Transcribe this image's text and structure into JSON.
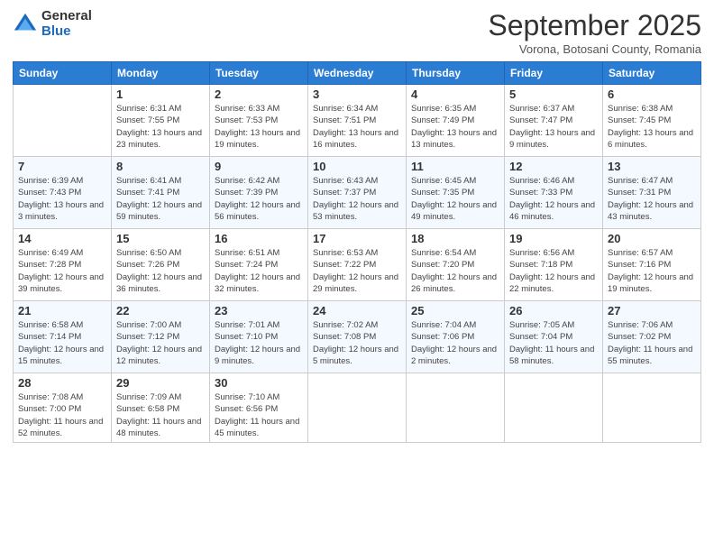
{
  "logo": {
    "general": "General",
    "blue": "Blue"
  },
  "header": {
    "month": "September 2025",
    "location": "Vorona, Botosani County, Romania"
  },
  "weekdays": [
    "Sunday",
    "Monday",
    "Tuesday",
    "Wednesday",
    "Thursday",
    "Friday",
    "Saturday"
  ],
  "weeks": [
    [
      {
        "day": "",
        "sunrise": "",
        "sunset": "",
        "daylight": ""
      },
      {
        "day": "1",
        "sunrise": "Sunrise: 6:31 AM",
        "sunset": "Sunset: 7:55 PM",
        "daylight": "Daylight: 13 hours and 23 minutes."
      },
      {
        "day": "2",
        "sunrise": "Sunrise: 6:33 AM",
        "sunset": "Sunset: 7:53 PM",
        "daylight": "Daylight: 13 hours and 19 minutes."
      },
      {
        "day": "3",
        "sunrise": "Sunrise: 6:34 AM",
        "sunset": "Sunset: 7:51 PM",
        "daylight": "Daylight: 13 hours and 16 minutes."
      },
      {
        "day": "4",
        "sunrise": "Sunrise: 6:35 AM",
        "sunset": "Sunset: 7:49 PM",
        "daylight": "Daylight: 13 hours and 13 minutes."
      },
      {
        "day": "5",
        "sunrise": "Sunrise: 6:37 AM",
        "sunset": "Sunset: 7:47 PM",
        "daylight": "Daylight: 13 hours and 9 minutes."
      },
      {
        "day": "6",
        "sunrise": "Sunrise: 6:38 AM",
        "sunset": "Sunset: 7:45 PM",
        "daylight": "Daylight: 13 hours and 6 minutes."
      }
    ],
    [
      {
        "day": "7",
        "sunrise": "Sunrise: 6:39 AM",
        "sunset": "Sunset: 7:43 PM",
        "daylight": "Daylight: 13 hours and 3 minutes."
      },
      {
        "day": "8",
        "sunrise": "Sunrise: 6:41 AM",
        "sunset": "Sunset: 7:41 PM",
        "daylight": "Daylight: 12 hours and 59 minutes."
      },
      {
        "day": "9",
        "sunrise": "Sunrise: 6:42 AM",
        "sunset": "Sunset: 7:39 PM",
        "daylight": "Daylight: 12 hours and 56 minutes."
      },
      {
        "day": "10",
        "sunrise": "Sunrise: 6:43 AM",
        "sunset": "Sunset: 7:37 PM",
        "daylight": "Daylight: 12 hours and 53 minutes."
      },
      {
        "day": "11",
        "sunrise": "Sunrise: 6:45 AM",
        "sunset": "Sunset: 7:35 PM",
        "daylight": "Daylight: 12 hours and 49 minutes."
      },
      {
        "day": "12",
        "sunrise": "Sunrise: 6:46 AM",
        "sunset": "Sunset: 7:33 PM",
        "daylight": "Daylight: 12 hours and 46 minutes."
      },
      {
        "day": "13",
        "sunrise": "Sunrise: 6:47 AM",
        "sunset": "Sunset: 7:31 PM",
        "daylight": "Daylight: 12 hours and 43 minutes."
      }
    ],
    [
      {
        "day": "14",
        "sunrise": "Sunrise: 6:49 AM",
        "sunset": "Sunset: 7:28 PM",
        "daylight": "Daylight: 12 hours and 39 minutes."
      },
      {
        "day": "15",
        "sunrise": "Sunrise: 6:50 AM",
        "sunset": "Sunset: 7:26 PM",
        "daylight": "Daylight: 12 hours and 36 minutes."
      },
      {
        "day": "16",
        "sunrise": "Sunrise: 6:51 AM",
        "sunset": "Sunset: 7:24 PM",
        "daylight": "Daylight: 12 hours and 32 minutes."
      },
      {
        "day": "17",
        "sunrise": "Sunrise: 6:53 AM",
        "sunset": "Sunset: 7:22 PM",
        "daylight": "Daylight: 12 hours and 29 minutes."
      },
      {
        "day": "18",
        "sunrise": "Sunrise: 6:54 AM",
        "sunset": "Sunset: 7:20 PM",
        "daylight": "Daylight: 12 hours and 26 minutes."
      },
      {
        "day": "19",
        "sunrise": "Sunrise: 6:56 AM",
        "sunset": "Sunset: 7:18 PM",
        "daylight": "Daylight: 12 hours and 22 minutes."
      },
      {
        "day": "20",
        "sunrise": "Sunrise: 6:57 AM",
        "sunset": "Sunset: 7:16 PM",
        "daylight": "Daylight: 12 hours and 19 minutes."
      }
    ],
    [
      {
        "day": "21",
        "sunrise": "Sunrise: 6:58 AM",
        "sunset": "Sunset: 7:14 PM",
        "daylight": "Daylight: 12 hours and 15 minutes."
      },
      {
        "day": "22",
        "sunrise": "Sunrise: 7:00 AM",
        "sunset": "Sunset: 7:12 PM",
        "daylight": "Daylight: 12 hours and 12 minutes."
      },
      {
        "day": "23",
        "sunrise": "Sunrise: 7:01 AM",
        "sunset": "Sunset: 7:10 PM",
        "daylight": "Daylight: 12 hours and 9 minutes."
      },
      {
        "day": "24",
        "sunrise": "Sunrise: 7:02 AM",
        "sunset": "Sunset: 7:08 PM",
        "daylight": "Daylight: 12 hours and 5 minutes."
      },
      {
        "day": "25",
        "sunrise": "Sunrise: 7:04 AM",
        "sunset": "Sunset: 7:06 PM",
        "daylight": "Daylight: 12 hours and 2 minutes."
      },
      {
        "day": "26",
        "sunrise": "Sunrise: 7:05 AM",
        "sunset": "Sunset: 7:04 PM",
        "daylight": "Daylight: 11 hours and 58 minutes."
      },
      {
        "day": "27",
        "sunrise": "Sunrise: 7:06 AM",
        "sunset": "Sunset: 7:02 PM",
        "daylight": "Daylight: 11 hours and 55 minutes."
      }
    ],
    [
      {
        "day": "28",
        "sunrise": "Sunrise: 7:08 AM",
        "sunset": "Sunset: 7:00 PM",
        "daylight": "Daylight: 11 hours and 52 minutes."
      },
      {
        "day": "29",
        "sunrise": "Sunrise: 7:09 AM",
        "sunset": "Sunset: 6:58 PM",
        "daylight": "Daylight: 11 hours and 48 minutes."
      },
      {
        "day": "30",
        "sunrise": "Sunrise: 7:10 AM",
        "sunset": "Sunset: 6:56 PM",
        "daylight": "Daylight: 11 hours and 45 minutes."
      },
      {
        "day": "",
        "sunrise": "",
        "sunset": "",
        "daylight": ""
      },
      {
        "day": "",
        "sunrise": "",
        "sunset": "",
        "daylight": ""
      },
      {
        "day": "",
        "sunrise": "",
        "sunset": "",
        "daylight": ""
      },
      {
        "day": "",
        "sunrise": "",
        "sunset": "",
        "daylight": ""
      }
    ]
  ]
}
